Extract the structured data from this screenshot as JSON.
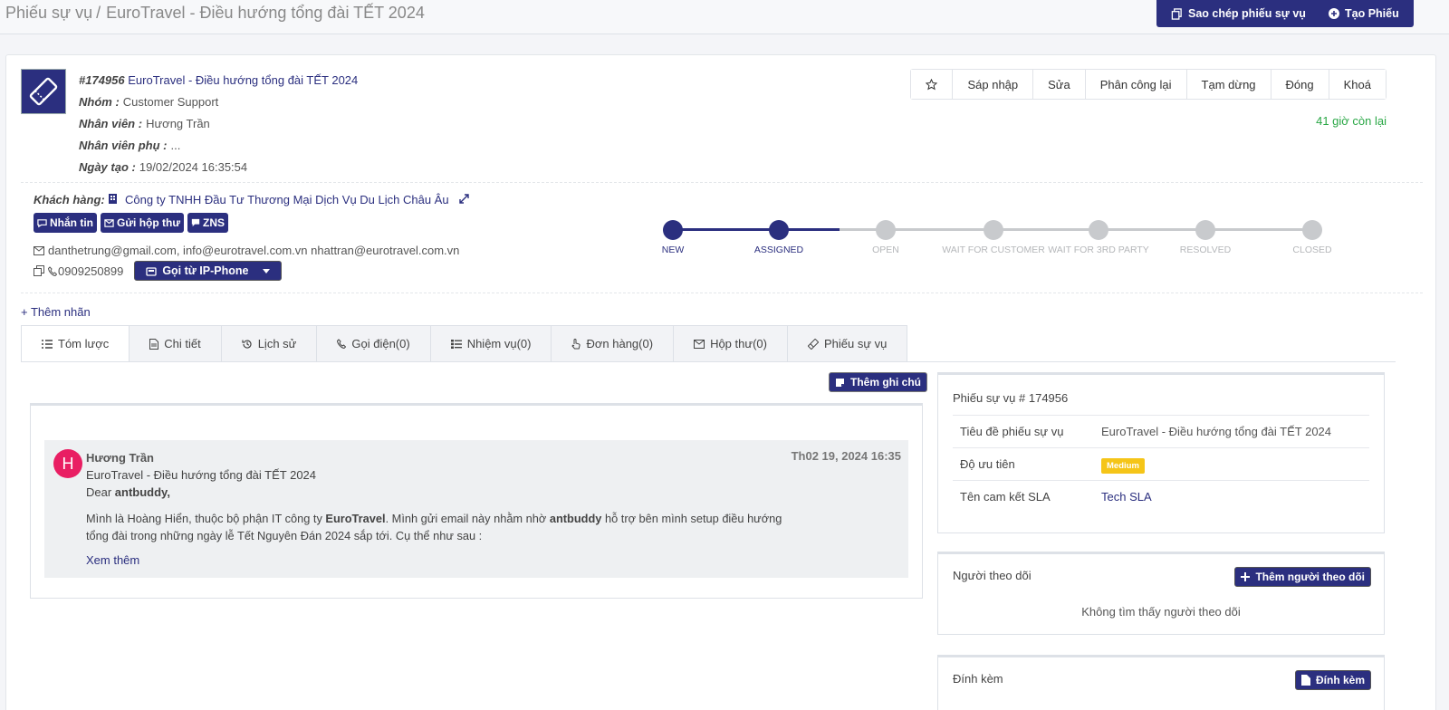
{
  "breadcrumb": {
    "root": "Phiếu sự vụ",
    "separator": "/",
    "current": "EuroTravel - Điều hướng tổng đài TẾT 2024"
  },
  "topbar": {
    "copy_label": "Sao chép phiếu sự vụ",
    "create_label": "Tạo Phiếu"
  },
  "ticket": {
    "number": "#174956",
    "title": "EuroTravel - Điều hướng tổng đài TẾT 2024",
    "group_label": "Nhóm :",
    "group": "Customer Support",
    "staff_label": "Nhân viên :",
    "staff": "Hương Trần",
    "sub_staff_label": "Nhân viên phụ :",
    "sub_staff": "...",
    "created_label": "Ngày tạo :",
    "created": "19/02/2024 16:35:54",
    "remaining": "41 giờ còn lại"
  },
  "actions": [
    "Sáp nhập",
    "Sửa",
    "Phân công lại",
    "Tạm dừng",
    "Đóng",
    "Khoá"
  ],
  "customer": {
    "label": "Khách hàng:",
    "name": "Công ty TNHH Đầu Tư Thương Mại Dịch Vụ Du Lịch Châu Âu",
    "message_btn": "Nhắn tin",
    "mail_btn": "Gửi hộp thư",
    "zns_btn": "ZNS",
    "emails": "danthetrung@gmail.com, info@eurotravel.com.vn nhattran@eurotravel.com.vn",
    "phone": "0909250899",
    "call_btn": "Gọi từ IP-Phone"
  },
  "progress": {
    "steps": [
      "NEW",
      "ASSIGNED",
      "OPEN",
      "WAIT FOR CUSTOMER",
      "WAIT FOR 3RD PARTY",
      "RESOLVED",
      "CLOSED"
    ],
    "current": 2,
    "active_color": "#2b2f7f",
    "inactive_color": "#c8cacd"
  },
  "add_label": "+ Thêm nhãn",
  "tabs": [
    "Tóm lược",
    "Chi tiết",
    "Lịch sử",
    "Gọi điện(0)",
    "Nhiệm vụ(0)",
    "Đơn hàng(0)",
    "Hộp thư(0)",
    "Phiếu sự vụ"
  ],
  "note_btn": "Thêm ghi chú",
  "message": {
    "avatar": "H",
    "author": "Hương Trần",
    "time": "Th02 19, 2024 16:35",
    "subject": "EuroTravel - Điều hướng tổng đài TẾT 2024",
    "greeting_prefix": "Dear ",
    "greeting_name": "antbuddy,",
    "p1": "Mình là Hoàng Hiển, thuộc bộ phận IT công ty ",
    "p1_bold": "EuroTravel",
    "p2": ". Mình gửi email này nhằm nhờ ",
    "p2_bold": "antbuddy",
    "p3": " hỗ trợ bên mình setup điều hướng tổng đài trong những ngày lễ Tết Nguyên Đán 2024 sắp tới. Cụ thể như sau :",
    "more": "Xem thêm"
  },
  "details": {
    "title": "Phiếu sự vụ # 174956",
    "rows": [
      {
        "k": "Tiêu đề phiếu sự vụ",
        "v": "EuroTravel - Điều hướng tổng đài TẾT 2024"
      },
      {
        "k": "Độ ưu tiên",
        "v": "Medium"
      },
      {
        "k": "Tên cam kết SLA",
        "v": "Tech SLA"
      }
    ]
  },
  "followers": {
    "title": "Người theo dõi",
    "add_btn": "Thêm người theo dõi",
    "empty": "Không tìm thấy người theo dõi"
  },
  "attachments": {
    "title": "Đính kèm",
    "add_btn": "Đính kèm"
  }
}
